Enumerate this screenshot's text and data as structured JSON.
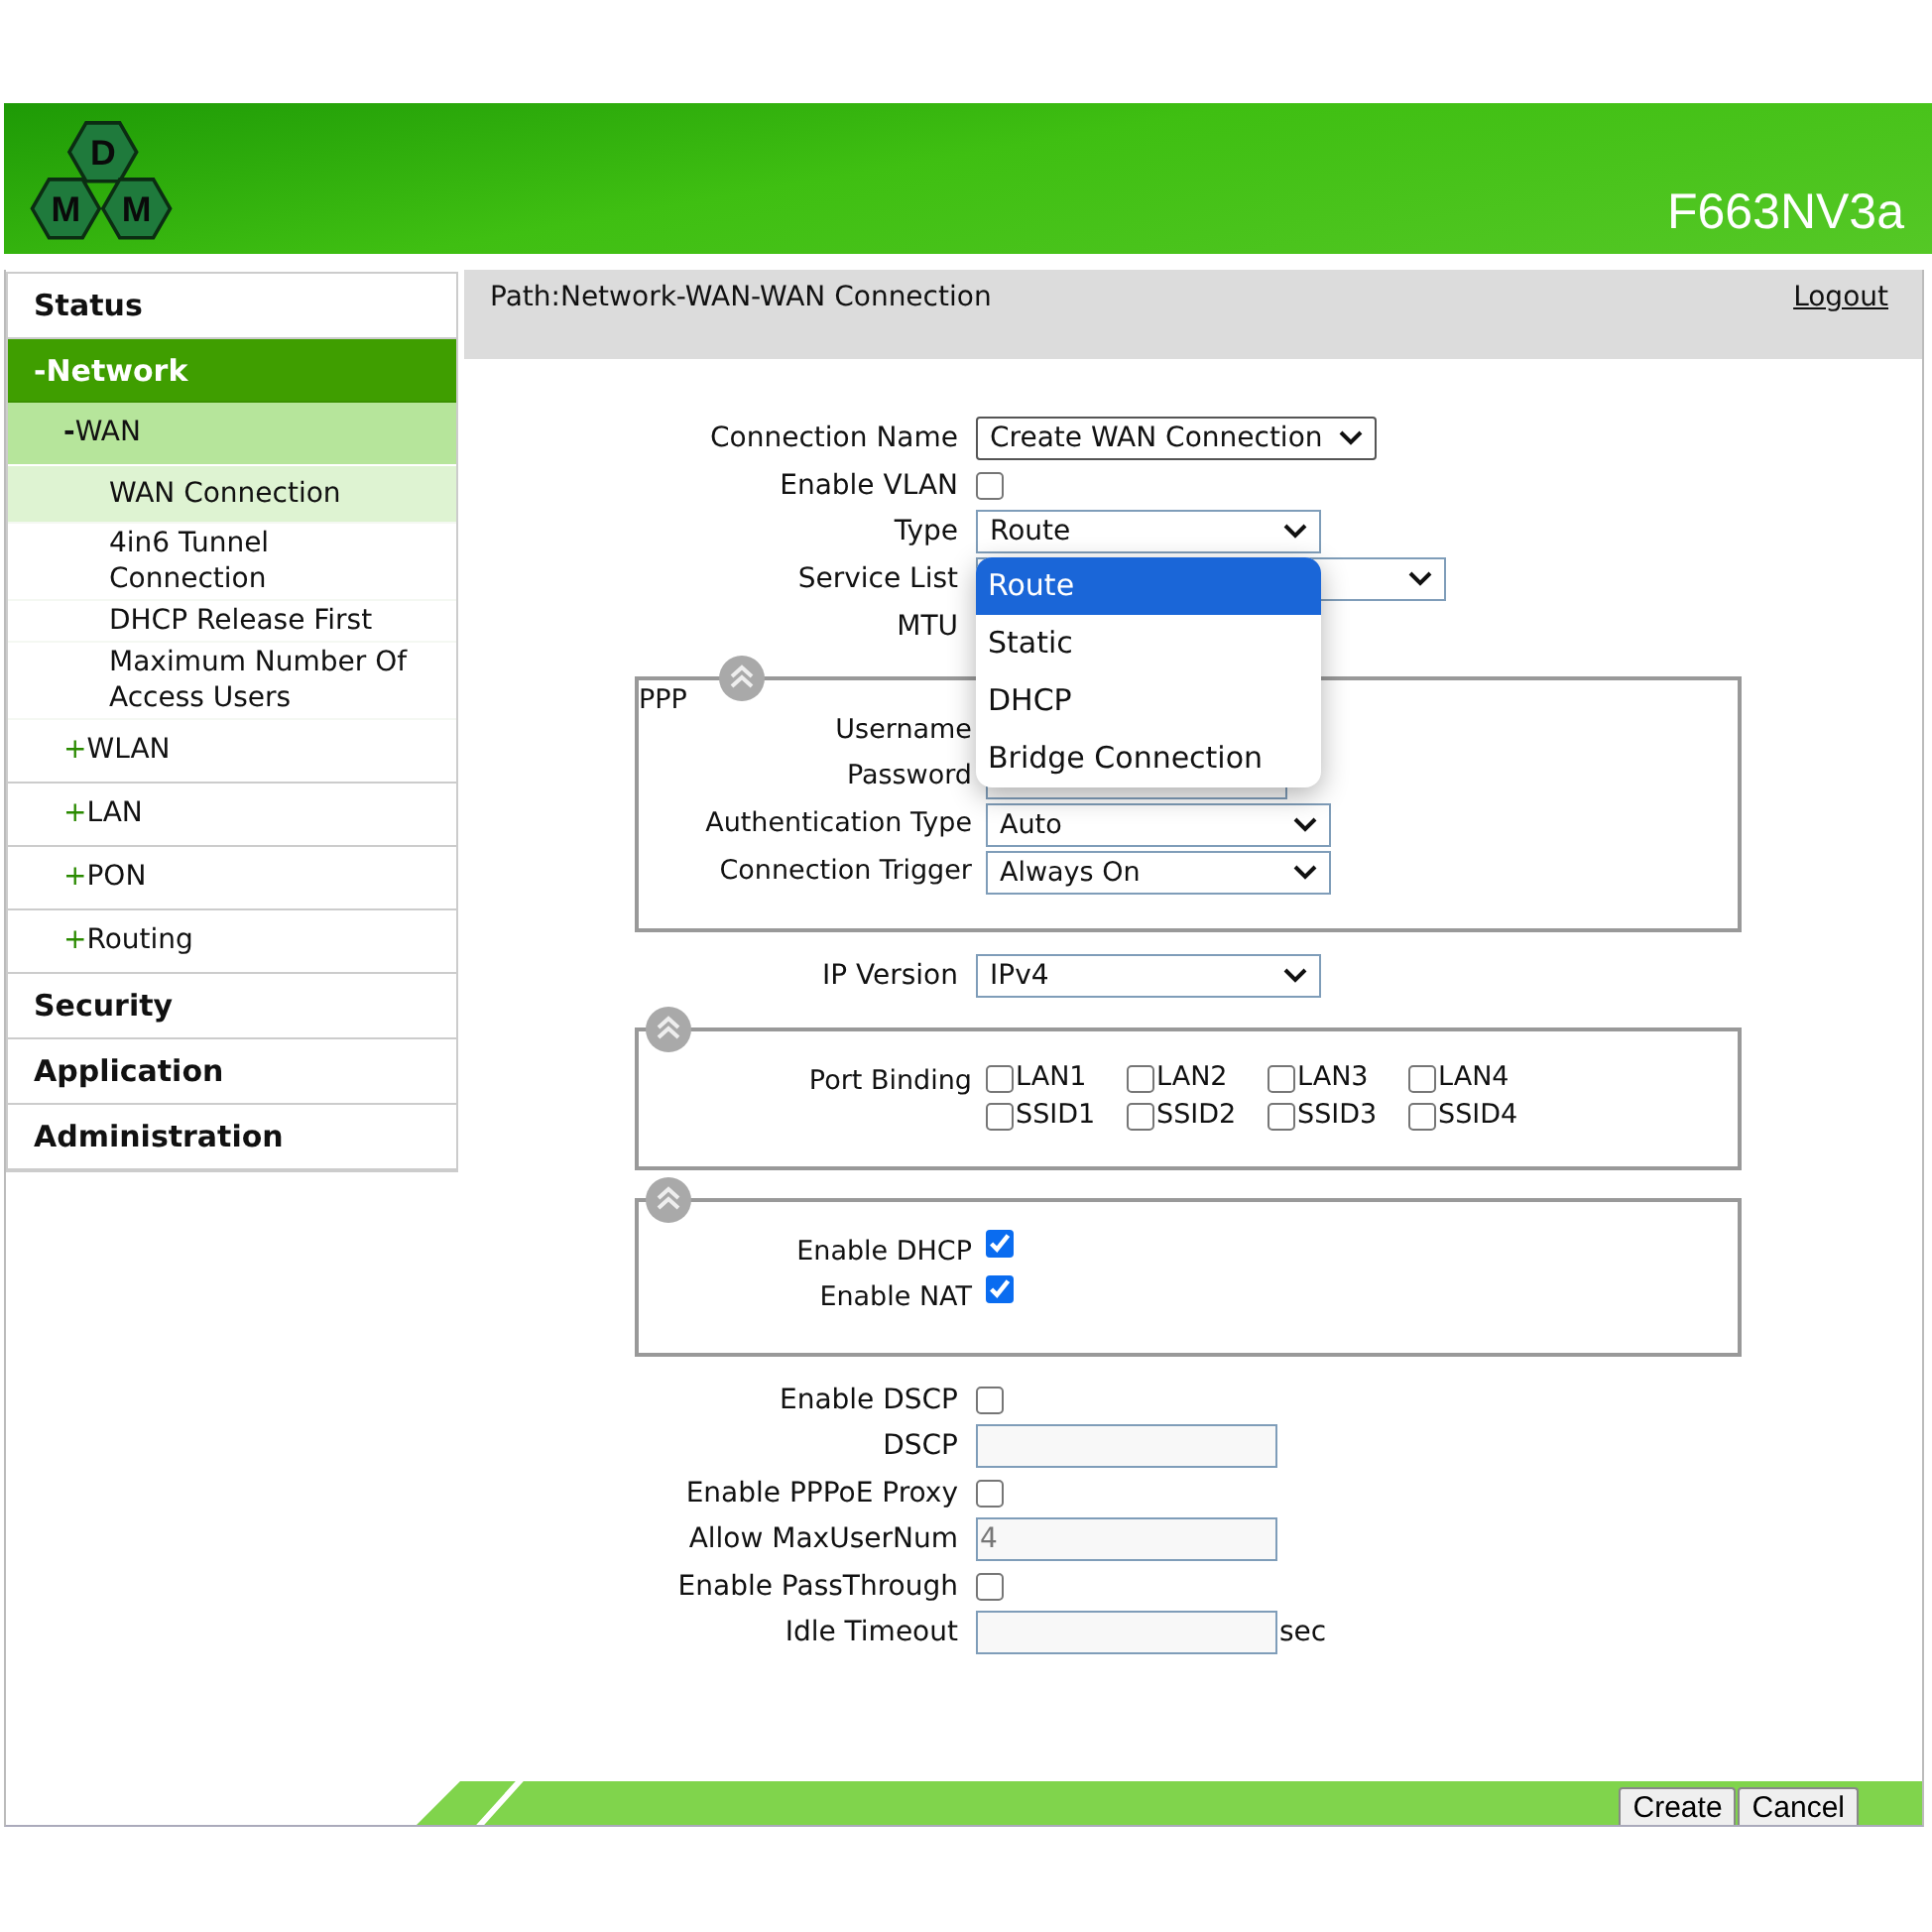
{
  "header": {
    "logo_letters": [
      "D",
      "M",
      "M"
    ],
    "model": "F663NV3a"
  },
  "sidebar": {
    "items": [
      {
        "label": "Status",
        "selected": false
      },
      {
        "toggle": "-",
        "label": "Network",
        "selected": true,
        "expanded": true,
        "children": [
          {
            "toggle": "-",
            "label": "WAN",
            "selected": true,
            "expanded": true,
            "children": [
              {
                "label": "WAN Connection",
                "selected": true
              },
              {
                "label": "4in6 Tunnel Connection",
                "selected": false
              },
              {
                "label": "DHCP Release First",
                "selected": false
              },
              {
                "label": "Maximum Number Of Access Users",
                "selected": false
              }
            ]
          },
          {
            "toggle": "+",
            "label": "WLAN",
            "selected": false
          },
          {
            "toggle": "+",
            "label": "LAN",
            "selected": false
          },
          {
            "toggle": "+",
            "label": "PON",
            "selected": false
          },
          {
            "toggle": "+",
            "label": "Routing",
            "selected": false
          }
        ]
      },
      {
        "label": "Security",
        "selected": false
      },
      {
        "label": "Application",
        "selected": false
      },
      {
        "label": "Administration",
        "selected": false
      }
    ]
  },
  "path": "Path:Network-WAN-WAN Connection",
  "logout": "Logout",
  "form": [
    {
      "kind": "select",
      "label": "Connection Name",
      "value": "Create WAN Connection"
    },
    {
      "kind": "checkbox",
      "label": "Enable VLAN",
      "checked": false
    },
    {
      "kind": "select",
      "label": "Type",
      "value": "Route",
      "open": true,
      "options": [
        {
          "label": "Route",
          "selected": true
        },
        {
          "label": "Static",
          "selected": false
        },
        {
          "label": "DHCP",
          "selected": false
        },
        {
          "label": "Bridge Connection",
          "selected": false
        }
      ]
    },
    {
      "kind": "select",
      "label": "Service List"
    },
    {
      "kind": "label",
      "label": "MTU"
    },
    {
      "kind": "section",
      "legend": "PPP",
      "items": [
        {
          "kind": "label",
          "label": "Username"
        },
        {
          "kind": "text",
          "label": "Password"
        },
        {
          "kind": "select",
          "label": "Authentication Type",
          "value": "Auto"
        },
        {
          "kind": "select",
          "label": "Connection Trigger",
          "value": "Always On"
        }
      ]
    },
    {
      "kind": "select",
      "label": "IP Version",
      "value": "IPv4"
    },
    {
      "kind": "section",
      "items": [
        {
          "kind": "checkgroup",
          "label": "Port Binding",
          "options": [
            {
              "label": "LAN1",
              "checked": false
            },
            {
              "label": "LAN2",
              "checked": false
            },
            {
              "label": "LAN3",
              "checked": false
            },
            {
              "label": "LAN4",
              "checked": false
            },
            {
              "label": "SSID1",
              "checked": false
            },
            {
              "label": "SSID2",
              "checked": false
            },
            {
              "label": "SSID3",
              "checked": false
            },
            {
              "label": "SSID4",
              "checked": false
            }
          ]
        }
      ]
    },
    {
      "kind": "section",
      "items": [
        {
          "kind": "checkbox",
          "label": "Enable DHCP",
          "checked": true
        },
        {
          "kind": "checkbox",
          "label": "Enable NAT",
          "checked": true
        }
      ]
    },
    {
      "kind": "checkbox",
      "label": "Enable DSCP",
      "checked": false
    },
    {
      "kind": "text",
      "label": "DSCP"
    },
    {
      "kind": "checkbox",
      "label": "Enable PPPoE Proxy",
      "checked": false
    },
    {
      "kind": "text",
      "label": "Allow MaxUserNum",
      "value": "4"
    },
    {
      "kind": "checkbox",
      "label": "Enable PassThrough",
      "checked": false
    },
    {
      "kind": "text",
      "label": "Idle Timeout",
      "unit": "sec"
    }
  ],
  "buttons": [
    "Create",
    "Cancel"
  ]
}
